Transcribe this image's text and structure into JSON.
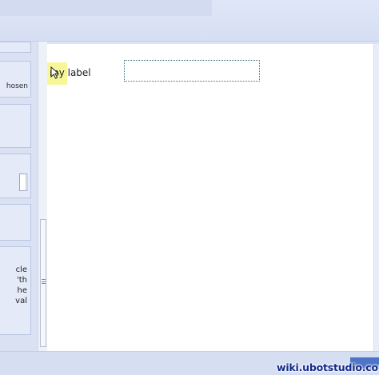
{
  "left_panel": {
    "boxes": [
      {
        "text": ""
      },
      {
        "text": "hosen"
      },
      {
        "text": ""
      },
      {
        "text": ""
      },
      {
        "text": ""
      },
      {
        "lines": [
          "cle",
          "'th",
          "he",
          "val"
        ]
      }
    ]
  },
  "canvas": {
    "label_text": "my label",
    "textbox_value": ""
  },
  "footer": {
    "watermark": "wiki.ubotstudio.com"
  },
  "colors": {
    "highlight": "#f7f79a",
    "footer_button": "#4f73c6",
    "watermark": "#122a8c"
  }
}
